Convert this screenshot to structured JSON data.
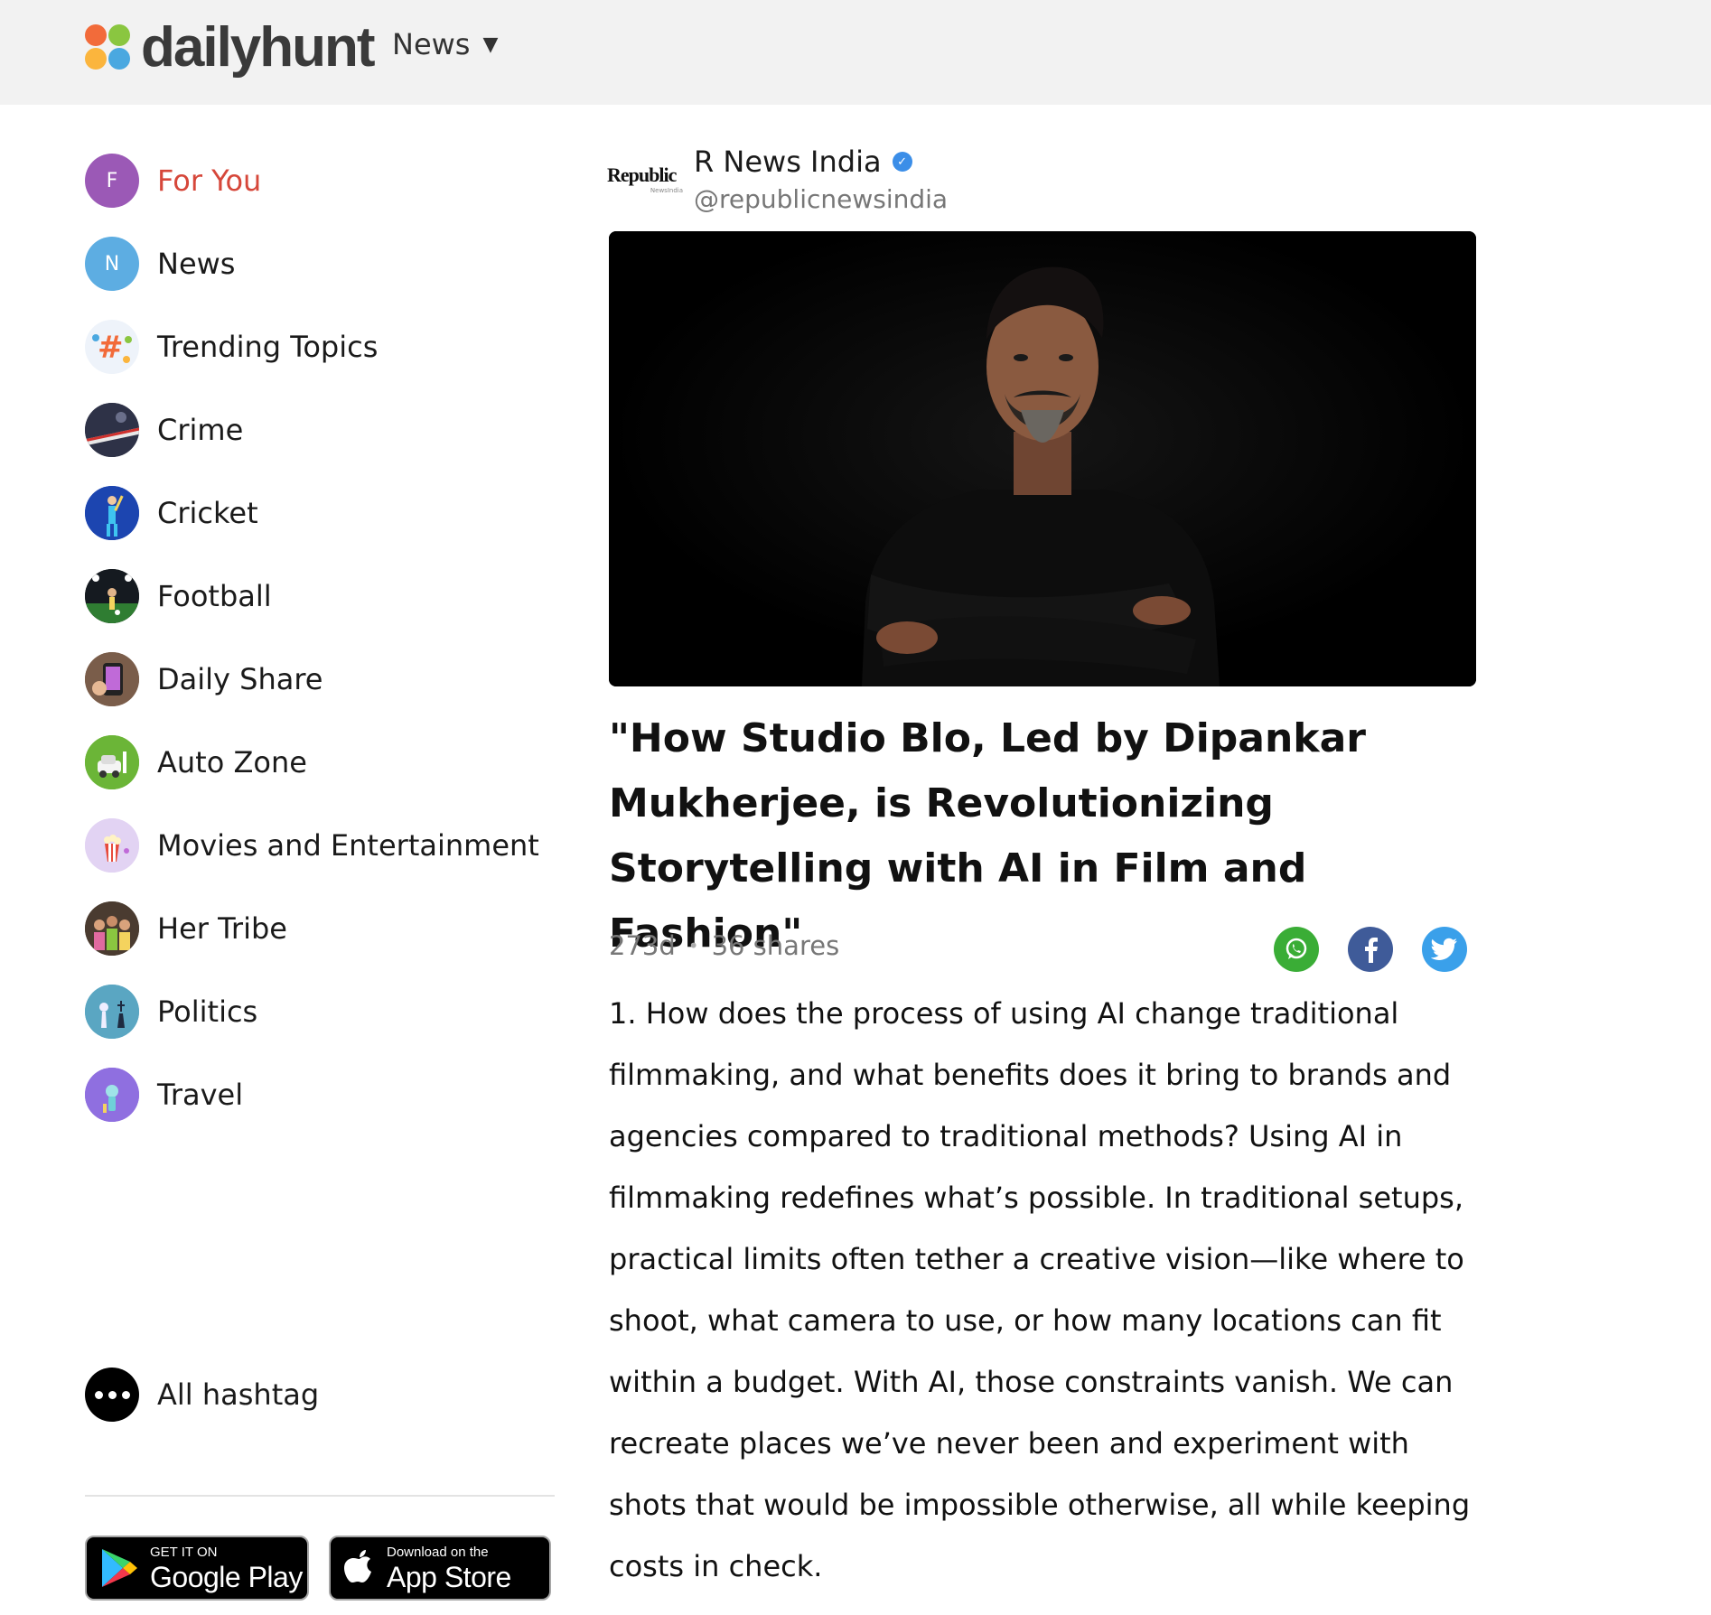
{
  "header": {
    "logo_text": "dailyhunt",
    "nav_label": "News"
  },
  "sidebar": {
    "items": [
      {
        "label": "For You",
        "letter": "F",
        "color": "#9b59b6",
        "active": true
      },
      {
        "label": "News",
        "letter": "N",
        "color": "#5dade2"
      },
      {
        "label": "Trending Topics"
      },
      {
        "label": "Crime"
      },
      {
        "label": "Cricket"
      },
      {
        "label": "Football"
      },
      {
        "label": "Daily Share"
      },
      {
        "label": "Auto Zone"
      },
      {
        "label": "Movies and Entertainment"
      },
      {
        "label": "Her Tribe"
      },
      {
        "label": "Politics"
      },
      {
        "label": "Travel"
      }
    ],
    "all_hashtag": "All hashtag",
    "google_play": {
      "small": "GET IT ON",
      "big": "Google Play"
    },
    "app_store": {
      "small": "Download on the",
      "big": "App Store"
    }
  },
  "article": {
    "publisher": {
      "logo_text": "Republic",
      "logo_sub": "NewsIndia",
      "name": "R News India",
      "handle": "@republicnewsindia"
    },
    "headline": "\"How Studio Blo, Led by Dipankar Mukherjee, is Revolutionizing Storytelling with AI in Film and Fashion\"",
    "age": "273d",
    "shares": "36 shares",
    "body": "1. How does the process of using AI change traditional filmmaking, and what benefits does it bring to brands and agencies compared to traditional methods? Using AI in filmmaking redefines what’s possible. In traditional setups, practical limits often tether a creative vision—like where to shoot, what camera to use, or how many locations can fit within a budget. With AI, those constraints vanish. We can recreate places we’ve never been and experiment with shots that would be impossible otherwise, all while keeping costs in check."
  }
}
